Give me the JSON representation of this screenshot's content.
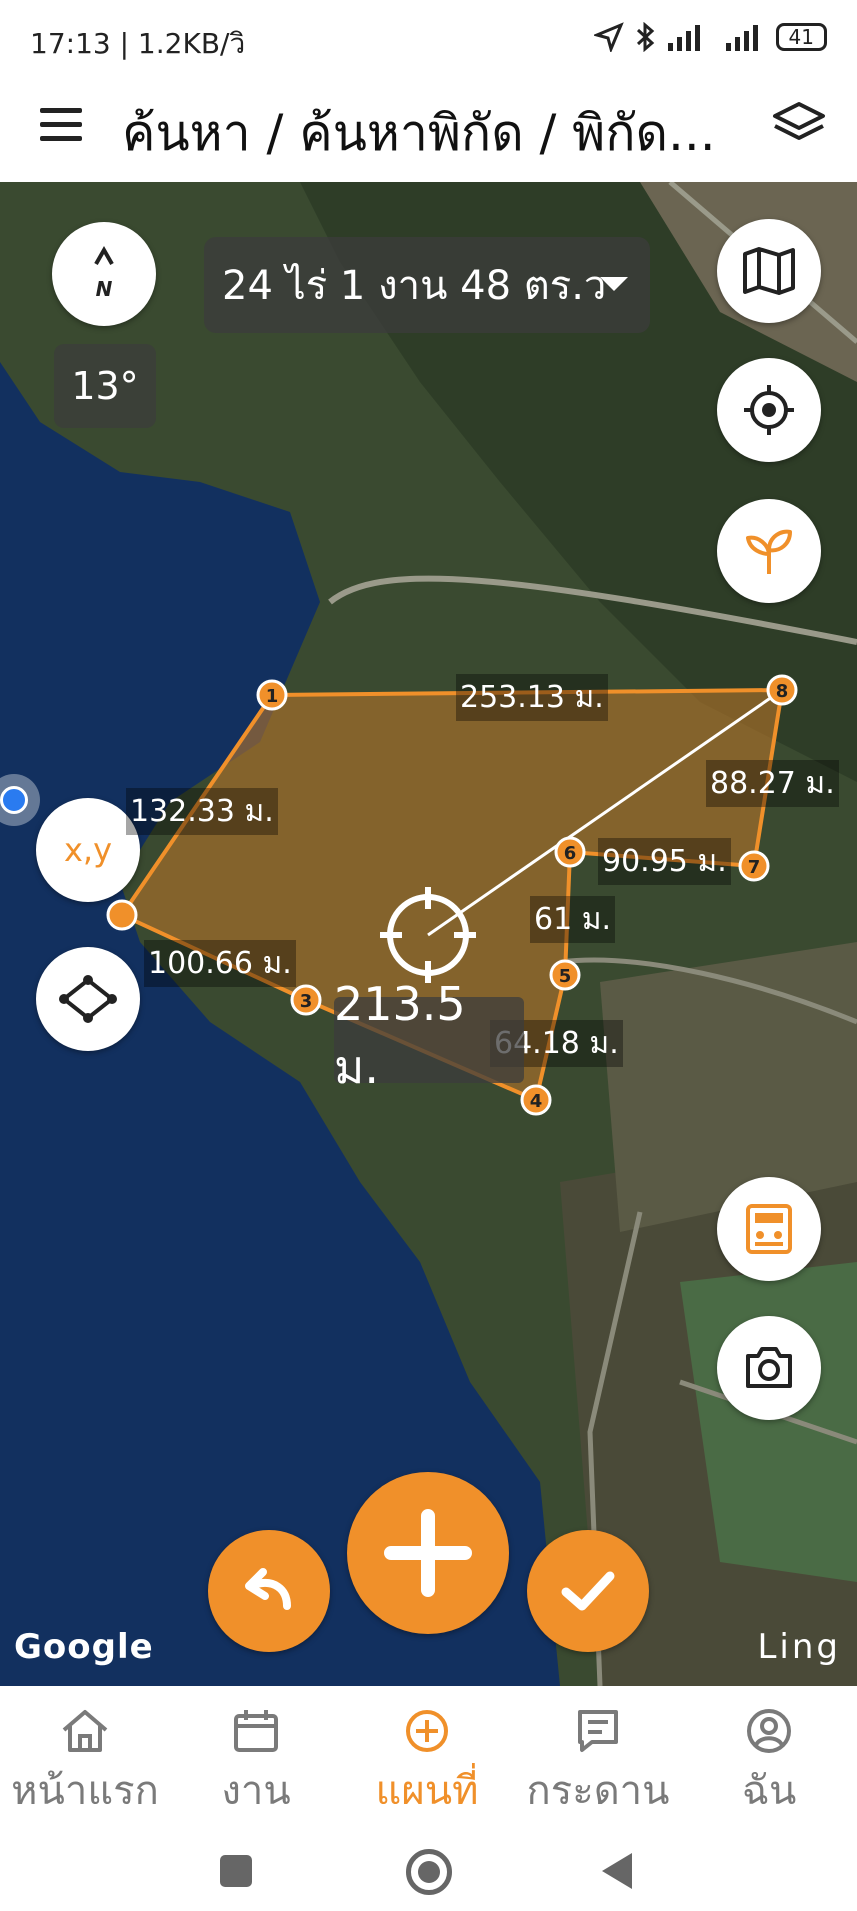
{
  "status_bar": {
    "time_info": "17:13 | 1.2KB/วิ",
    "battery": "41"
  },
  "app_bar": {
    "title": "ค้นหา / ค้นหาพิกัด / พิกัด..."
  },
  "map": {
    "area_text": "24 ไร่ 1 งาน 48 ตร.ว",
    "bearing": "13°",
    "compass_label": "N",
    "xy_label": "x,y",
    "segment_labels": [
      "253.13 ม.",
      "88.27 ม.",
      "132.33 ม.",
      "90.95 ม.",
      "61 ม.",
      "100.66 ม.",
      "64.18 ม."
    ],
    "vertex_numbers": [
      "1",
      "3",
      "4",
      "5",
      "6",
      "7",
      "8"
    ],
    "current_distance": "213.5 ม.",
    "google_logo": "Google",
    "watermark": "Ling"
  },
  "bottom_nav": {
    "items": [
      {
        "label": "หน้าแรก",
        "icon": "home-icon"
      },
      {
        "label": "งาน",
        "icon": "calendar-icon"
      },
      {
        "label": "แผนที่",
        "icon": "plus-circle-icon",
        "active": true
      },
      {
        "label": "กระดาน",
        "icon": "board-icon"
      },
      {
        "label": "ฉัน",
        "icon": "user-icon"
      }
    ]
  },
  "colors": {
    "accent": "#f0902a",
    "polygon_fill": "#b5742a",
    "water": "#0f2a55"
  }
}
